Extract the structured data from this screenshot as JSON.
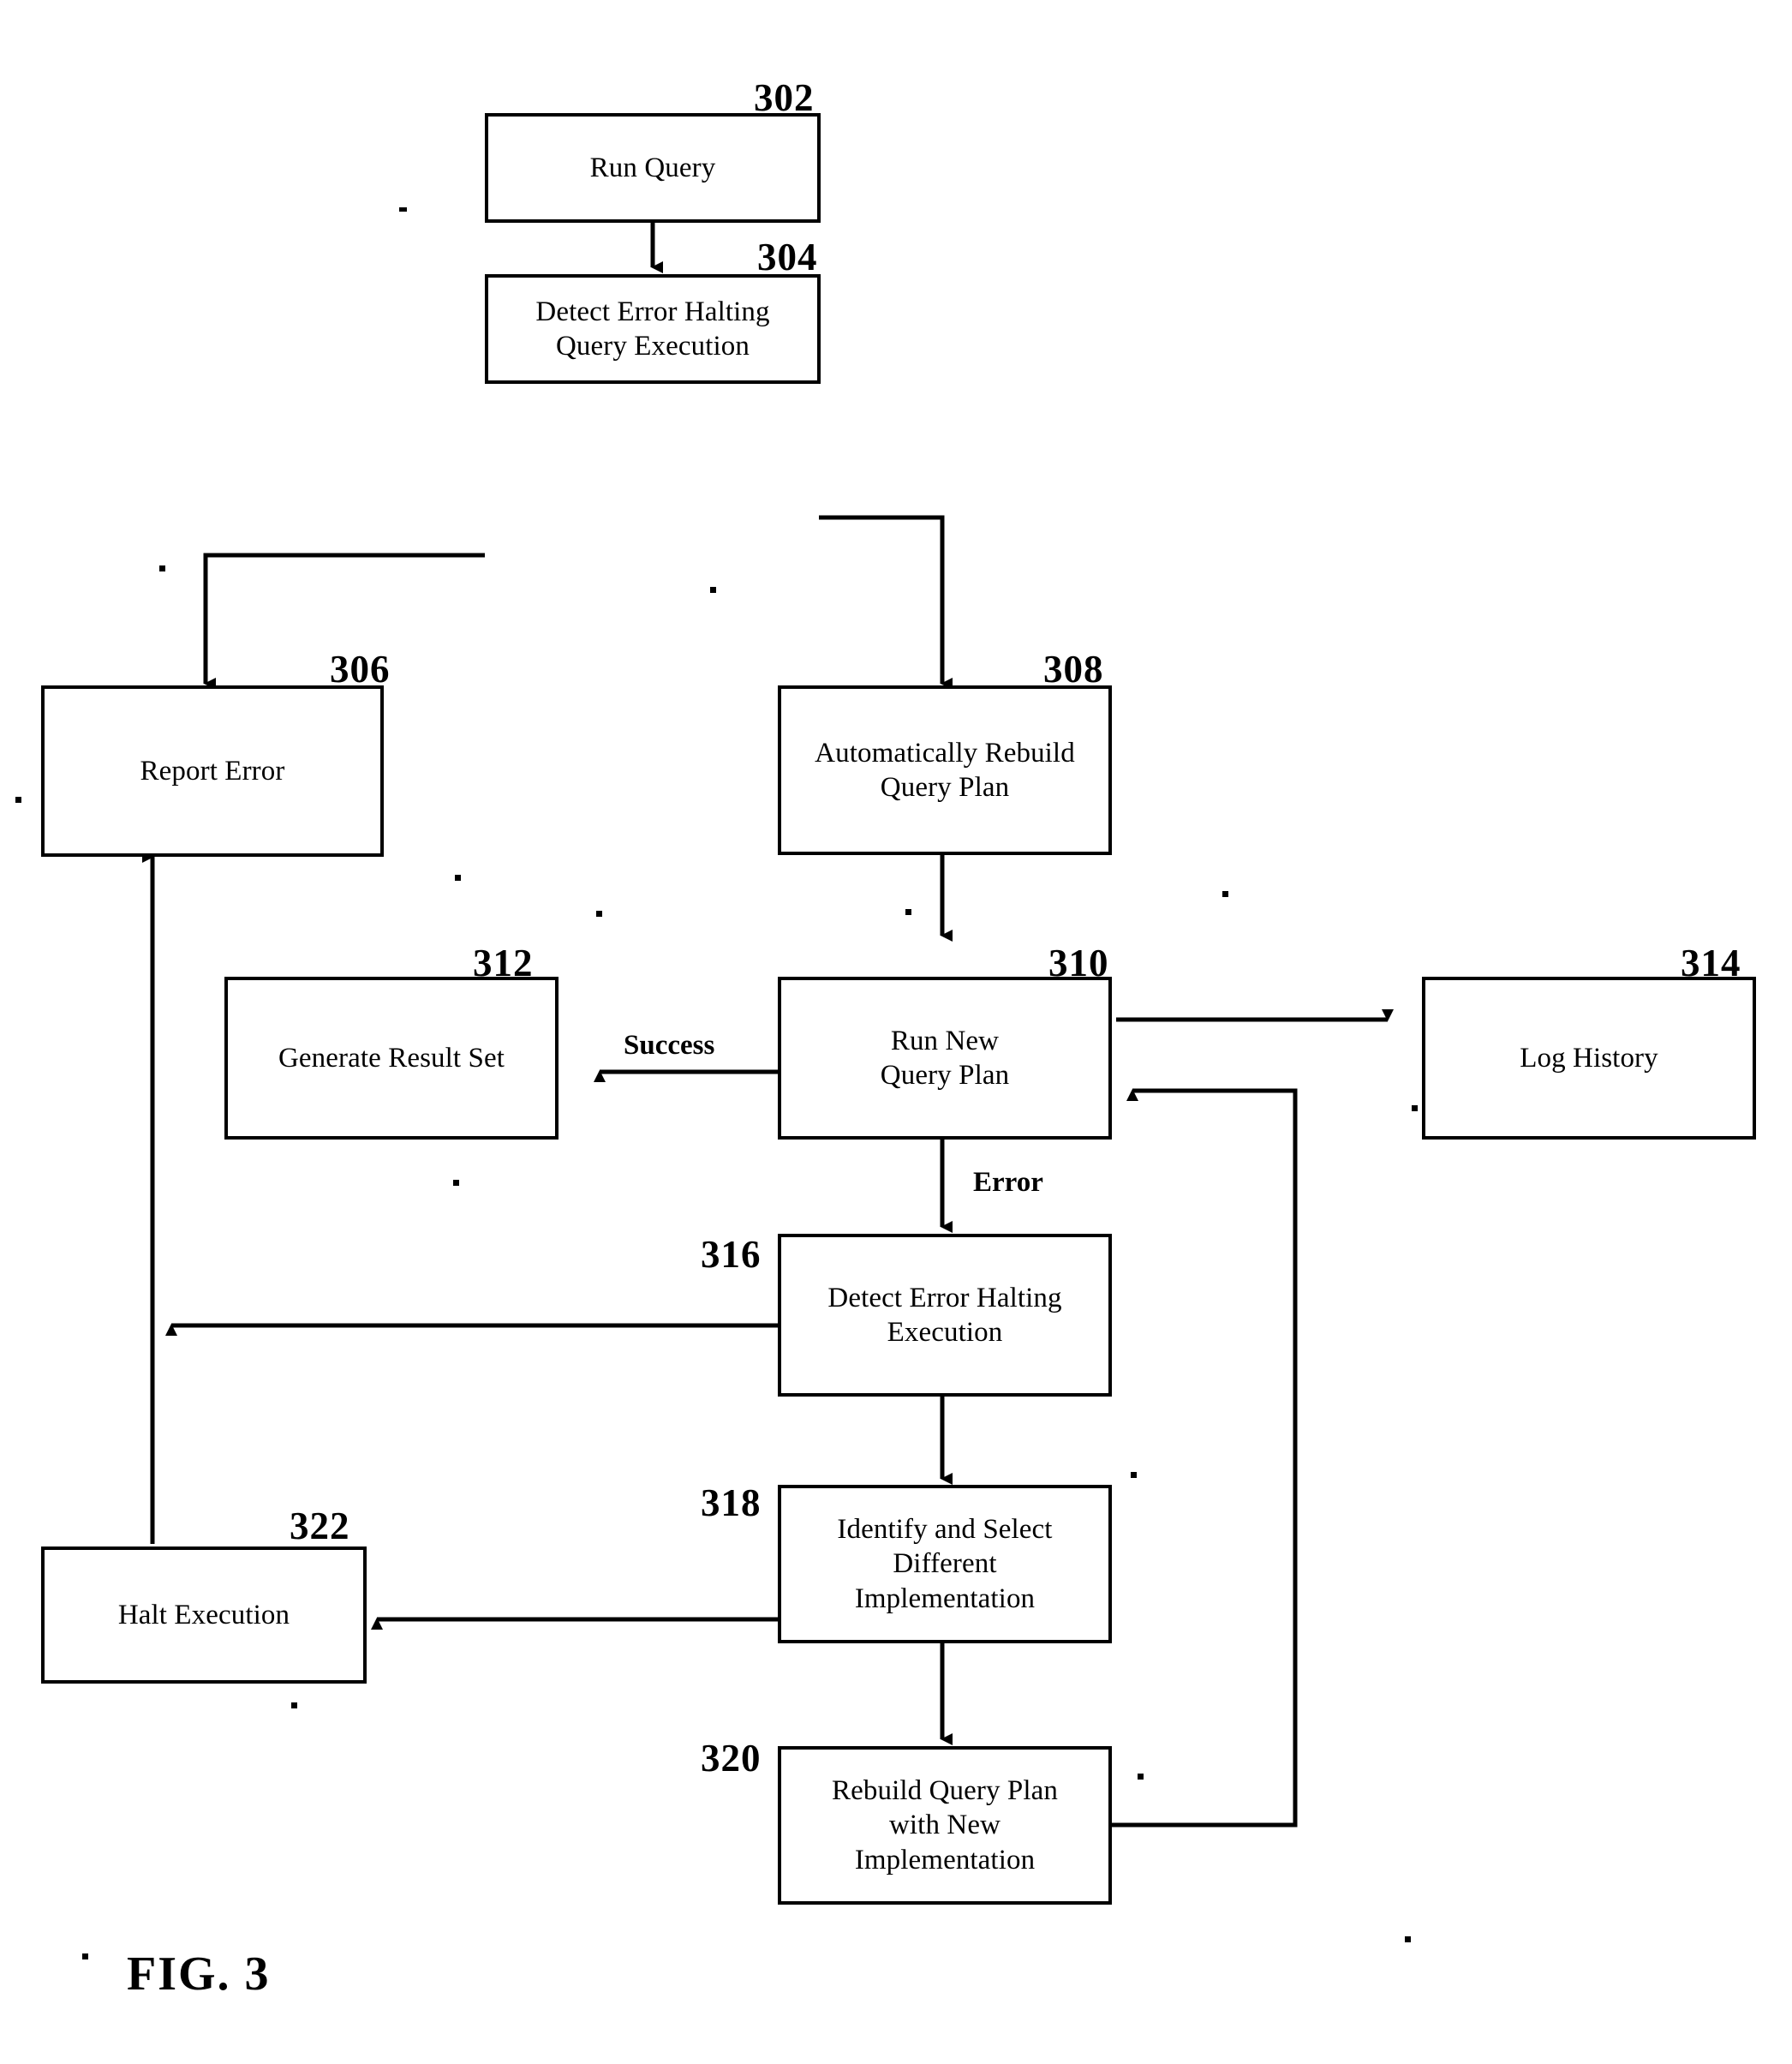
{
  "figure": {
    "caption": "FIG. 3",
    "nodes": [
      {
        "ref": "302",
        "label": "Run Query"
      },
      {
        "ref": "304",
        "label": "Detect Error Halting\nQuery Execution"
      },
      {
        "ref": "306",
        "label": "Report Error"
      },
      {
        "ref": "308",
        "label": "Automatically Rebuild\nQuery Plan"
      },
      {
        "ref": "310",
        "label": "Run New\nQuery Plan"
      },
      {
        "ref": "312",
        "label": "Generate Result Set"
      },
      {
        "ref": "314",
        "label": "Log History"
      },
      {
        "ref": "316",
        "label": "Detect  Error Halting\nExecution"
      },
      {
        "ref": "318",
        "label": "Identify and Select\nDifferent\nImplementation"
      },
      {
        "ref": "320",
        "label": "Rebuild Query Plan\nwith New\nImplementation"
      },
      {
        "ref": "322",
        "label": "Halt Execution"
      }
    ],
    "edge_labels": [
      {
        "name": "success",
        "text": "Success"
      },
      {
        "name": "error",
        "text": "Error"
      }
    ],
    "colors": {
      "ink": "#000000",
      "paper": "#ffffff"
    }
  }
}
